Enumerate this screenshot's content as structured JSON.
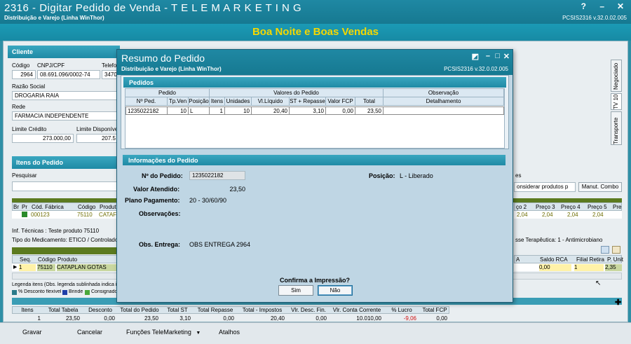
{
  "window": {
    "title": "2316 - Digitar Pedido de Venda - T E L E M A R K E T I N G",
    "subtitle": "Distribuição e Varejo (Linha WinThor)",
    "code": "PCSIS2316  v.32.0.02.005",
    "banner": "Boa Noite e Boas Vendas",
    "controls": {
      "help": "?",
      "minimize": "–",
      "close": "✕"
    }
  },
  "cliente": {
    "header": "Cliente",
    "codigo_label": "Código",
    "codigo": "2964",
    "cnpj_label": "CNPJ/CPF",
    "cnpj": "08.691.096/0002-74",
    "telefone_label": "Telefo",
    "telefone": "34703",
    "razao_label": "Razão Social",
    "razao": "DROGARIA RAIA",
    "rede_label": "Rede",
    "rede": "FARMACIA INDEPENDENTE",
    "limite_label": "Limite Crédito",
    "limite": "273.000,00",
    "disponivel_label": "Limite Disponível",
    "disponivel": "207.5"
  },
  "side_tabs": [
    "Negociado",
    "TV 10",
    "Transporte"
  ],
  "itens": {
    "header": "Itens do Pedido",
    "pesquisar_label": "Pesquisar",
    "filter_text": "es",
    "considerar": "onsiderar produtos p",
    "manut_button": "Manut. Combo",
    "grid_headers": [
      "Br",
      "Pr",
      "Cód. Fábrica",
      "Código",
      "Produto"
    ],
    "grid_row": [
      "000123",
      "75110",
      "CATAF"
    ],
    "preco_headers": [
      "ço 2",
      "Preço 3",
      "Preço 4",
      "Preço 5",
      "Pre"
    ],
    "preco_values": [
      "2,04",
      "2,04",
      "2,04",
      "2,04"
    ],
    "inf_tecnicas": "Inf. Técnicas : Teste produto 75110",
    "tipo_medicamento": "Tipo do Medicamento: ETICO / Controlado: ",
    "classe": "sse Terapêutica: 1 - Antimicrobiano",
    "grid2_headers": [
      "Seq.",
      "Código",
      "Produto"
    ],
    "grid2_row": [
      "1",
      "75110",
      "CATAPLAN GOTAS"
    ],
    "grid2_right_headers": [
      "A",
      "Saldo RCA",
      "Filial Retira",
      "P. Unit"
    ],
    "grid2_right_values": [
      "0,00",
      "1",
      "2,35"
    ],
    "legenda": "Legenda itens (Obs. legenda sublinhada indica inc",
    "legenda_items": [
      "% Desconto flexível",
      "Brinde",
      "Consignado"
    ]
  },
  "totals": {
    "headers": [
      "Itens",
      "Total Tabela",
      "Desconto",
      "Total do Pedido",
      "Total ST",
      "Total Repasse",
      "Total - Impostos",
      "Vlr. Desc. Fin.",
      "Vlr. Conta Corrente",
      "% Lucro",
      "Total FCP"
    ],
    "values": [
      "1",
      "23,50",
      "0,00",
      "23,50",
      "3,10",
      "0,00",
      "20,40",
      "0,00",
      "10.010,00",
      "-9,06",
      "0,00"
    ]
  },
  "footer": {
    "gravar": "Gravar",
    "cancelar": "Cancelar",
    "funcoes": "Funções TeleMarketing",
    "atalhos": "Atalhos"
  },
  "dialog": {
    "title": "Resumo do Pedido",
    "subtitle": "Distribuição e Varejo (Linha WinThor)",
    "code": "PCSIS2316  v.32.0.02.005",
    "pedidos_header": "Pedidos",
    "group_headers": [
      "Pedido",
      "Valores do Pedido",
      "Observação"
    ],
    "col_headers": [
      "Nº Ped.",
      "Tp.Ven",
      "Posição",
      "Itens",
      "Unidades",
      "Vl.Líquido",
      "ST + Repasse",
      "Valor FCP",
      "Total",
      "Detalhamento"
    ],
    "row": [
      "1235022182",
      "10",
      "L",
      "1",
      "10",
      "20,40",
      "3,10",
      "0,00",
      "23,50",
      ""
    ],
    "info_header": "Informações do Pedido",
    "num_pedido_label": "Nº do Pedido:",
    "num_pedido": "1235022182",
    "posicao_label": "Posição:",
    "posicao": "L - Liberado",
    "valor_label": "Valor Atendido:",
    "valor": "23,50",
    "plano_label": "Plano Pagamento:",
    "plano": "20 - 30/60/90",
    "obs_label": "Observações:",
    "obs_entrega_label": "Obs. Entrega:",
    "obs_entrega": "OBS ENTREGA 2964",
    "confirm_text": "Confirma a Impressão?",
    "sim": "Sim",
    "nao": "Não"
  }
}
